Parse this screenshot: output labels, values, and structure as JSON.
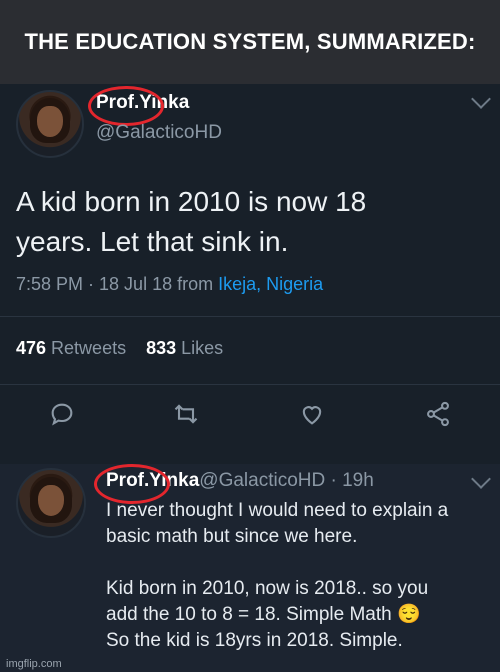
{
  "caption": "THE EDUCATION SYSTEM, SUMMARIZED:",
  "tweet": {
    "display_name_a": "Prof. ",
    "display_name_b": "Yinka",
    "handle": "@GalacticoHD",
    "text_line1": "A kid born in 2010 is now 18",
    "text_line2": "years. Let that sink in.",
    "time": "7:58 PM · 18 Jul 18 from ",
    "location": "Ikeja, Nigeria",
    "retweets_count": "476",
    "retweets_label": " Retweets",
    "likes_count": "833",
    "likes_label": " Likes",
    "icons": [
      "reply-icon",
      "retweet-icon",
      "like-icon",
      "share-icon",
      "chevron-down-icon"
    ]
  },
  "reply": {
    "display_name_a": "Prof. ",
    "display_name_b": "Yinka",
    "handle": " @GalacticoHD · 19h",
    "line1": "I never thought I would need to explain a",
    "line2": "basic math but since we here.",
    "line3": "Kid born in 2010, now is 2018.. so you",
    "line4": "add the 10 to 8 = 18. Simple Math 😌",
    "line5": "So the kid is 18yrs in 2018. Simple."
  },
  "watermark": "imgflip.com",
  "colors": {
    "highlight_circle": "#e3262d",
    "link": "#1d9bf0",
    "background": "#182029"
  }
}
